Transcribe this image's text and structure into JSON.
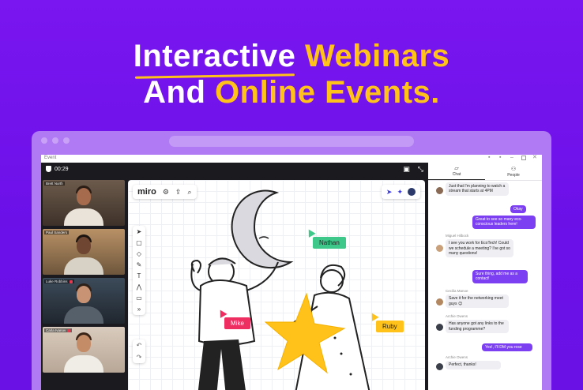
{
  "headline": {
    "line1_word1": "Interactive",
    "line1_word2": "Webinars",
    "line2_word1": "And",
    "line2_word2": "Online Events."
  },
  "app": {
    "window_title": "Event",
    "timer": "00:29"
  },
  "participants": [
    {
      "name": "Brett North",
      "muted": false
    },
    {
      "name": "Paul Sanders",
      "muted": false
    },
    {
      "name": "Luke Robbins",
      "muted": true
    },
    {
      "name": "Carla Ivanov",
      "muted": true
    }
  ],
  "board": {
    "logo": "miro",
    "tags": [
      {
        "label": "Nathan",
        "color": "#3ec98a"
      },
      {
        "label": "Mike",
        "color": "#ee2e61"
      },
      {
        "label": "Ruby",
        "color": "#ffc21a"
      }
    ]
  },
  "chat": {
    "tabs": [
      {
        "label": "Chat"
      },
      {
        "label": "People"
      }
    ],
    "messages": [
      {
        "sender": "",
        "text": "Just that I'm planning to watch a stream that starts at 4PM",
        "me": false
      },
      {
        "sender": "",
        "text": "Okay",
        "me": true
      },
      {
        "sender": "",
        "text": "Great to see so many eco-conscious leaders here!",
        "me": true
      },
      {
        "sender": "Miguel Hilbock",
        "text": "I see you work for EcoTech! Could we schedule a meeting? I've got so many questions!",
        "me": false
      },
      {
        "sender": "",
        "text": "Sure thing, add me as a contact!",
        "me": true
      },
      {
        "sender": "Cecilia Manoe",
        "text": "Save it for the networking meet guys 😉",
        "me": false
      },
      {
        "sender": "Archie Owens",
        "text": "Has anyone got any links to the funding programme?",
        "me": false
      },
      {
        "sender": "",
        "text": "Yes!, I'll DM you rose",
        "me": true
      },
      {
        "sender": "Archie Owens",
        "text": "Perfect, thanks!",
        "me": false
      }
    ]
  },
  "colors": {
    "background": "#7015ec",
    "accent_yellow": "#ffc21a",
    "chat_accent": "#7c3ff2"
  }
}
